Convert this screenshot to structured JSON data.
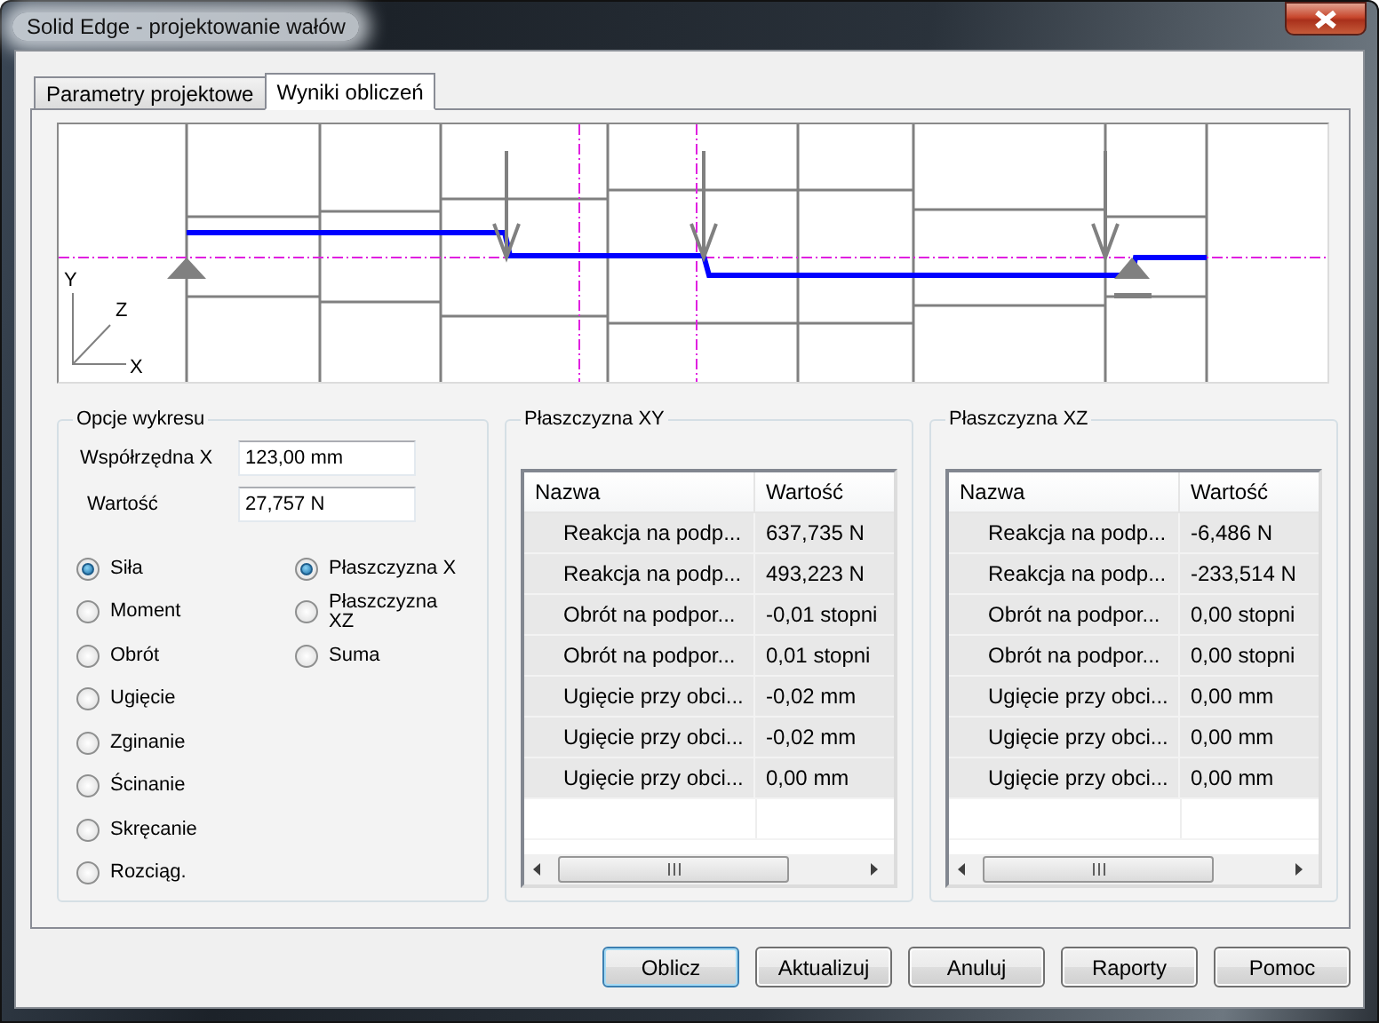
{
  "window": {
    "title": "Solid Edge - projektowanie wałów"
  },
  "tabs": [
    {
      "label": "Parametry projektowe",
      "selected": false
    },
    {
      "label": "Wyniki obliczeń",
      "selected": true
    }
  ],
  "diagram": {
    "axis_labels": [
      "Y",
      "Z",
      "X"
    ]
  },
  "options": {
    "title": "Opcje wykresu",
    "fields": [
      {
        "label": "Współrzędna X",
        "value": "123,00 mm"
      },
      {
        "label": "Wartość",
        "value": "27,757 N"
      }
    ],
    "quantities": [
      {
        "label": "Siła",
        "selected": true
      },
      {
        "label": "Moment",
        "selected": false
      },
      {
        "label": "Obrót",
        "selected": false
      },
      {
        "label": "Ugięcie",
        "selected": false
      },
      {
        "label": "Zginanie",
        "selected": false
      },
      {
        "label": "Ścinanie",
        "selected": false
      },
      {
        "label": "Skręcanie",
        "selected": false
      },
      {
        "label": "Rozciąg.",
        "selected": false
      }
    ],
    "planes": [
      {
        "label": "Płaszczyzna X",
        "selected": true
      },
      {
        "label": "Płaszczyzna XZ",
        "selected": false
      },
      {
        "label": "Suma",
        "selected": false
      }
    ]
  },
  "tables": [
    {
      "title": "Płaszczyzna XY",
      "columns": [
        "Nazwa",
        "Wartość"
      ],
      "rows": [
        [
          "Reakcja na podp...",
          "637,735 N"
        ],
        [
          "Reakcja na podp...",
          "493,223 N"
        ],
        [
          "Obrót na podpor...",
          "-0,01 stopni"
        ],
        [
          "Obrót na podpor...",
          "0,01 stopni"
        ],
        [
          "Ugięcie przy obci...",
          "-0,02 mm"
        ],
        [
          "Ugięcie przy obci...",
          "-0,02 mm"
        ],
        [
          "Ugięcie przy obci...",
          "0,00 mm"
        ]
      ]
    },
    {
      "title": "Płaszczyzna XZ",
      "columns": [
        "Nazwa",
        "Wartość"
      ],
      "rows": [
        [
          "Reakcja na podp...",
          "-6,486 N"
        ],
        [
          "Reakcja na podp...",
          "-233,514 N"
        ],
        [
          "Obrót na podpor...",
          "0,00 stopni"
        ],
        [
          "Obrót na podpor...",
          "0,00 stopni"
        ],
        [
          "Ugięcie przy obci...",
          "0,00 mm"
        ],
        [
          "Ugięcie przy obci...",
          "0,00 mm"
        ],
        [
          "Ugięcie przy obci...",
          "0,00 mm"
        ]
      ]
    }
  ],
  "buttons": [
    {
      "label": "Oblicz",
      "default": true
    },
    {
      "label": "Aktualizuj",
      "default": false
    },
    {
      "label": "Anuluj",
      "default": false
    },
    {
      "label": "Raporty",
      "default": false
    },
    {
      "label": "Pomoc",
      "default": false
    }
  ]
}
